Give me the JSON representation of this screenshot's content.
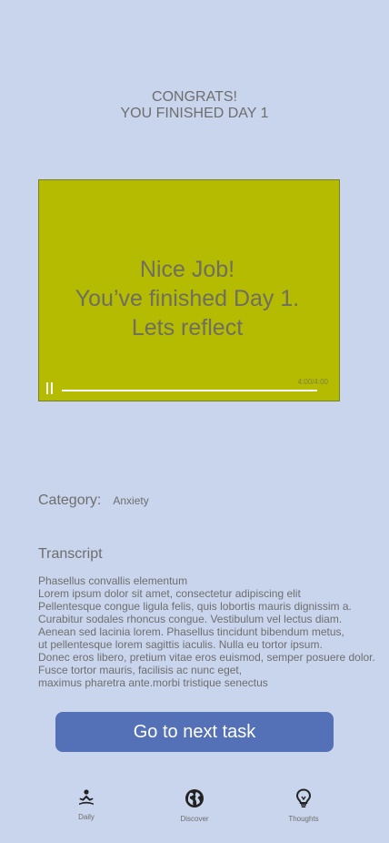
{
  "header": {
    "line1": "CONGRATS!",
    "line2": "YOU FINISHED DAY 1"
  },
  "video": {
    "message_lines": [
      "Nice Job!",
      "You’ve finished Day 1.",
      "Lets reflect"
    ],
    "time": "4:00/4:00",
    "progress": 1.0,
    "state": "playing"
  },
  "category": {
    "label": "Category:",
    "value": "Anxiety"
  },
  "transcript": {
    "title": "Transcript",
    "lines": [
      "Phasellus convallis elementum",
      "Lorem ipsum dolor sit amet, consectetur adipiscing elit",
      "Pellentesque congue ligula felis, quis lobortis mauris dignissim a.",
      "Curabitur sodales rhoncus congue. Vestibulum vel lectus diam.",
      "Aenean sed lacinia lorem. Phasellus tincidunt bibendum metus,",
      "ut pellentesque lorem sagittis iaculis. Nulla eu tortor ipsum.",
      "Donec eros libero, pretium vitae eros euismod, semper posuere dolor.",
      "Fusce tortor mauris, facilisis ac nunc eget,",
      "maximus pharetra ante.morbi tristique senectus"
    ]
  },
  "next_button": {
    "label": "Go to next task"
  },
  "tabbar": {
    "tabs": [
      {
        "label": "Daily",
        "icon": "meditation-icon"
      },
      {
        "label": "Discover",
        "icon": "globe-icon"
      },
      {
        "label": "Thoughts",
        "icon": "lightbulb-icon"
      }
    ]
  },
  "colors": {
    "background": "#c9d5ec",
    "video_background": "#b4bb00",
    "button": "#5470b6",
    "text": "#6e6e6e"
  }
}
